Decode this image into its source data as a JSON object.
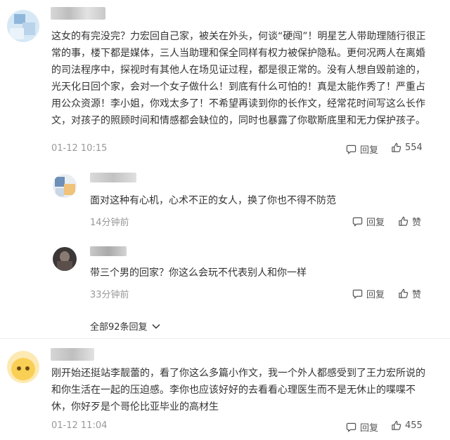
{
  "comments": [
    {
      "text": "这女的有完没完？力宏回自己家，被关在外头，何谈“硬闯”！明星艺人带助理随行很正常的事，楼下都是媒体，三人当助理和保全同样有权力被保护隐私。更何况两人在离婚的司法程序中，探视时有其他人在场见证过程，都是很正常的。没有人想自毁前途的，光天化日回个家，会对一个女子做什么！到底有什么可怕的！真是太能作秀了！严重占用公众资源！李小姐，你戏太多了！不希望再读到你的长作文，经常花时间写这么长作文，对孩子的照顾时间和情感都会缺位的，同时也暴露了你歇斯底里和无力保护孩子。",
      "time": "01-12 10:15",
      "reply_label": "回复",
      "likes": "554"
    },
    {
      "text": "刚开始还挺站李靓蕾的，看了你这么多篇小作文，我一个外人都感受到了王力宏所说的和你生活在一起的压迫感。李你也应该好好的去看看心理医生而不是无休止的喋喋不休，你好歹是个哥伦比亚毕业的高材生",
      "time": "01-12 11:04",
      "reply_label": "回复",
      "likes": "455"
    }
  ],
  "replies": [
    {
      "text": "面对这种有心机，心术不正的女人，换了你也不得不防范",
      "time": "14分钟前",
      "reply_label": "回复",
      "like_label": "赞"
    },
    {
      "text": "带三个男的回家？你这么会玩不代表别人和你一样",
      "time": "33分钟前",
      "reply_label": "回复",
      "like_label": "赞"
    }
  ],
  "show_all_replies": "全部92条回复",
  "icons": {
    "reply": "comment-bubble-icon",
    "like": "thumbs-up-icon",
    "expand": "chevron-down-icon"
  },
  "colors": {
    "text": "#333333",
    "meta": "#999999",
    "divider": "#eeeeee"
  }
}
